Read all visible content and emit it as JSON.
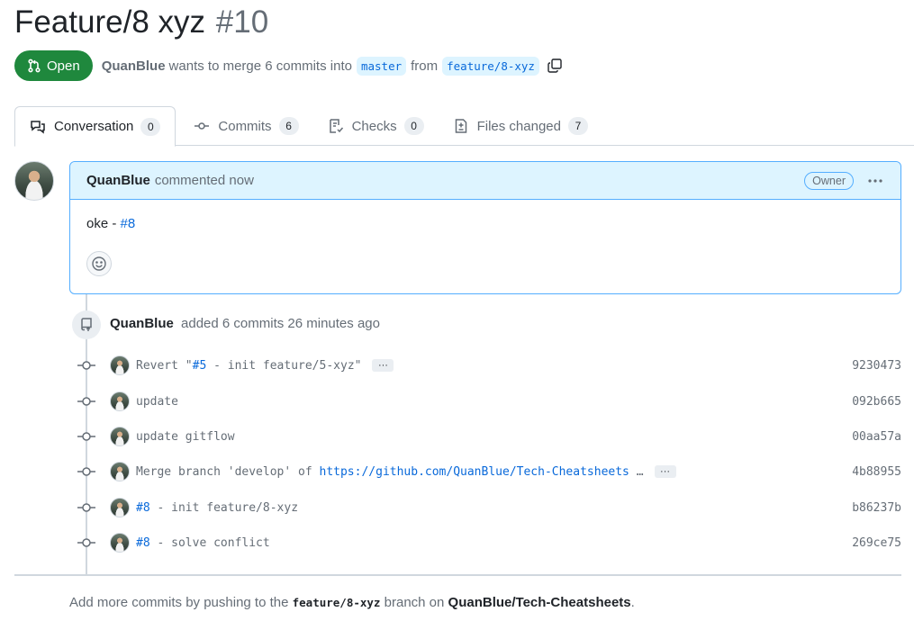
{
  "pr": {
    "title": "Feature/8 xyz",
    "number": "#10",
    "state": "Open",
    "author": "QuanBlue",
    "merge_text_1": "wants to merge 6 commits into",
    "base_branch": "master",
    "merge_text_2": "from",
    "head_branch": "feature/8-xyz"
  },
  "tabs": [
    {
      "label": "Conversation",
      "count": "0",
      "icon": "comment-discussion-icon"
    },
    {
      "label": "Commits",
      "count": "6",
      "icon": "git-commit-icon"
    },
    {
      "label": "Checks",
      "count": "0",
      "icon": "checklist-icon"
    },
    {
      "label": "Files changed",
      "count": "7",
      "icon": "file-diff-icon"
    }
  ],
  "comment": {
    "author": "QuanBlue",
    "time": "commented now",
    "badge": "Owner",
    "body_text": "oke - ",
    "body_link": "#8"
  },
  "event": {
    "author": "QuanBlue",
    "text": "added 6 commits 26 minutes ago"
  },
  "commits": [
    {
      "pre": "Revert \"",
      "link": "#5",
      "post": " - init feature/5-xyz\"",
      "more": true,
      "sha": "9230473"
    },
    {
      "pre": "update",
      "link": "",
      "post": "",
      "more": false,
      "sha": "092b665"
    },
    {
      "pre": "update gitflow",
      "link": "",
      "post": "",
      "more": false,
      "sha": "00aa57a"
    },
    {
      "pre": "Merge branch 'develop' of ",
      "link": "https://github.com/QuanBlue/Tech-Cheatsheets",
      "post": " …",
      "more": true,
      "sha": "4b88955"
    },
    {
      "pre": "",
      "link": "#8",
      "post": " - init feature/8-xyz",
      "more": false,
      "sha": "b86237b"
    },
    {
      "pre": "",
      "link": "#8",
      "post": " - solve conflict",
      "more": false,
      "sha": "269ce75"
    }
  ],
  "footer": {
    "text_1": "Add more commits by pushing to the",
    "branch": "feature/8-xyz",
    "text_2": "branch on",
    "repo": "QuanBlue/Tech-Cheatsheets",
    "text_3": "."
  },
  "colors": {
    "open_green": "#1f883d",
    "link_blue": "#0969da",
    "comment_header_bg": "#ddf4ff",
    "border": "#d0d7de"
  }
}
